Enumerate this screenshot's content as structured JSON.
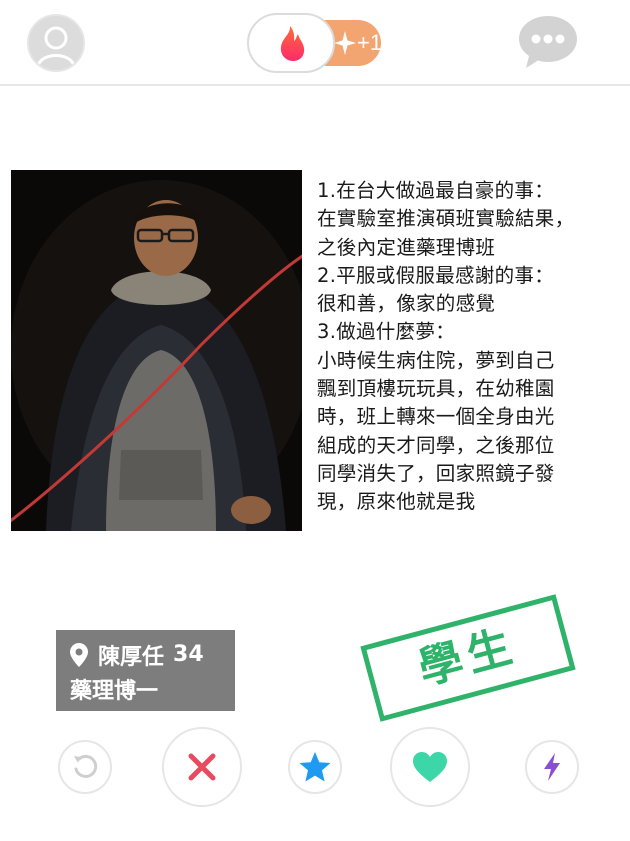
{
  "header": {
    "avatar_icon": "profile-avatar-icon",
    "logo_icon": "flame-icon",
    "plus_icon": "sparkle-icon",
    "plus_count": "+1",
    "chat_icon": "chat-bubble-icon"
  },
  "card": {
    "photo_icon": "profile-photo",
    "bio_lines": [
      "1.在台大做過最自豪的事：",
      "在實驗室推演碩班實驗結果，",
      "之後內定進藥理博班",
      "2.平服或假服最感謝的事：",
      "很和善，像家的感覺",
      "3.做過什麼夢：",
      "小時候生病住院，夢到自己",
      "飄到頂樓玩玩具，在幼稚園",
      "時，班上轉來一個全身由光",
      "組成的天才同學，之後那位",
      "同學消失了，回家照鏡子發",
      "現，原來他就是我"
    ],
    "name": "陳厚任",
    "age": "34",
    "subtitle": "藥理博一",
    "stamp": "學生"
  },
  "actions": {
    "rewind_icon": "rewind-icon",
    "nope_icon": "close-icon",
    "super_like_icon": "star-icon",
    "like_icon": "heart-icon",
    "boost_icon": "lightning-icon"
  },
  "colors": {
    "brand": "#fd4e6a",
    "plus": "#f2a571",
    "stamp": "#2fb36a",
    "nope": "#e84a5f",
    "super_like": "#1e9bf0",
    "like": "#3dd6a8",
    "boost": "#8a4ed6",
    "rewind": "#d0d0d0"
  }
}
